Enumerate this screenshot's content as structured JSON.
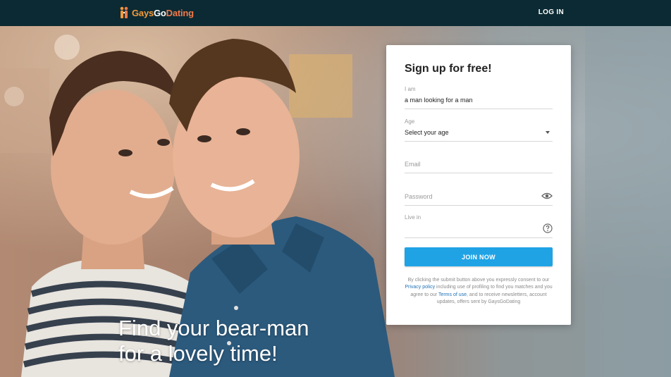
{
  "header": {
    "logo_parts": [
      "Gays",
      "Go",
      "Dating"
    ],
    "login_label": "LOG IN"
  },
  "hero": {
    "tagline_line1": "Find your bear-man",
    "tagline_line2": "for a lovely time!"
  },
  "signup": {
    "title": "Sign up for free!",
    "iam_label": "I am",
    "iam_value": "a man looking for a man",
    "age_label": "Age",
    "age_value": "Select your age",
    "email_placeholder": "Email",
    "password_placeholder": "Password",
    "livein_label": "Live in",
    "join_label": "JOIN NOW",
    "consent_1": "By clicking the submit button above you expressly consent to our ",
    "privacy_link": "Privacy policy",
    "consent_2": " including use of profiling to find you matches and you agree to our ",
    "terms_link": "Terms of use",
    "consent_3": ", and to receive newsletters, account updates, offers sent by GaysGoDating"
  },
  "colors": {
    "topbar": "#0c2a33",
    "button": "#1fa3e5",
    "link": "#1e72b8"
  },
  "icons": [
    "logo-mark-icon",
    "eye-icon",
    "help-icon",
    "chevron-down-icon"
  ]
}
